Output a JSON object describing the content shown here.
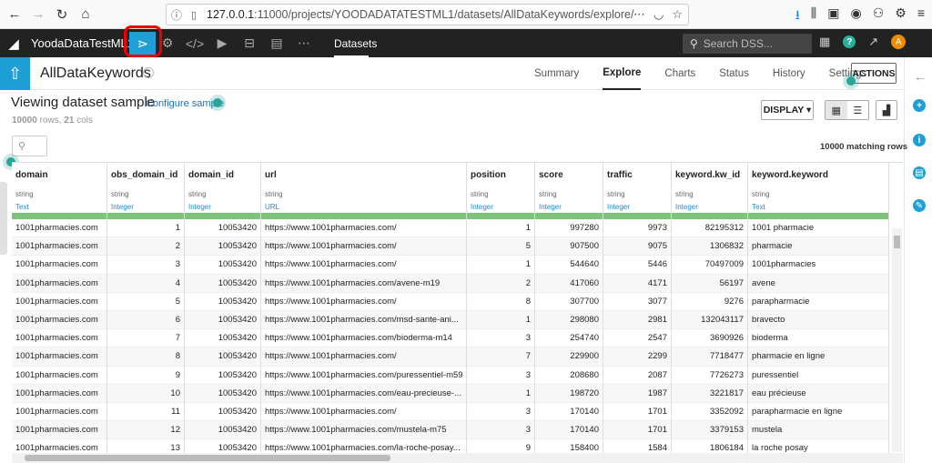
{
  "browser": {
    "url_host": "127.0.0.1",
    "url_rest": ":11000/projects/YOODADATATESTML1/datasets/AllDataKeywords/explore/",
    "more_icon": "⋯"
  },
  "dss": {
    "project_name": "YoodaDataTestML1",
    "nav_datasets": "Datasets",
    "search_placeholder": "Search DSS...",
    "avatar_letter": "A",
    "help_label": "?"
  },
  "dataset": {
    "name": "AllDataKeywords",
    "tabs": [
      "Summary",
      "Explore",
      "Charts",
      "Status",
      "History",
      "Settings"
    ],
    "actions_label": "ACTIONS"
  },
  "sample": {
    "title": "Viewing dataset sample",
    "configure_label": "Configure sample",
    "rows_label": "10000",
    "rows_suffix": "rows,",
    "cols_label": "21",
    "cols_suffix": "cols",
    "display_label": "DISPLAY ▾",
    "matching": "10000 matching rows"
  },
  "table": {
    "columns": [
      {
        "name": "domain",
        "storage": "string",
        "meaning": "Text"
      },
      {
        "name": "obs_domain_id",
        "storage": "string",
        "meaning": "Integer"
      },
      {
        "name": "domain_id",
        "storage": "string",
        "meaning": "Integer"
      },
      {
        "name": "url",
        "storage": "string",
        "meaning": "URL"
      },
      {
        "name": "position",
        "storage": "string",
        "meaning": "Integer"
      },
      {
        "name": "score",
        "storage": "string",
        "meaning": "Integer"
      },
      {
        "name": "traffic",
        "storage": "string",
        "meaning": "Integer"
      },
      {
        "name": "keyword.kw_id",
        "storage": "string",
        "meaning": "Integer"
      },
      {
        "name": "keyword.keyword",
        "storage": "string",
        "meaning": "Text"
      }
    ],
    "rows": [
      [
        "1001pharmacies.com",
        "1",
        "10053420",
        "https://www.1001pharmacies.com/",
        "1",
        "997280",
        "9973",
        "82195312",
        "1001 pharmacie"
      ],
      [
        "1001pharmacies.com",
        "2",
        "10053420",
        "https://www.1001pharmacies.com/",
        "5",
        "907500",
        "9075",
        "1306832",
        "pharmacie"
      ],
      [
        "1001pharmacies.com",
        "3",
        "10053420",
        "https://www.1001pharmacies.com/",
        "1",
        "544640",
        "5446",
        "70497009",
        "1001pharmacies"
      ],
      [
        "1001pharmacies.com",
        "4",
        "10053420",
        "https://www.1001pharmacies.com/avene-m19",
        "2",
        "417060",
        "4171",
        "56197",
        "avene"
      ],
      [
        "1001pharmacies.com",
        "5",
        "10053420",
        "https://www.1001pharmacies.com/",
        "8",
        "307700",
        "3077",
        "9276",
        "parapharmacie"
      ],
      [
        "1001pharmacies.com",
        "6",
        "10053420",
        "https://www.1001pharmacies.com/msd-sante-ani...",
        "1",
        "298080",
        "2981",
        "132043117",
        "bravecto"
      ],
      [
        "1001pharmacies.com",
        "7",
        "10053420",
        "https://www.1001pharmacies.com/bioderma-m14",
        "3",
        "254740",
        "2547",
        "3690926",
        "bioderma"
      ],
      [
        "1001pharmacies.com",
        "8",
        "10053420",
        "https://www.1001pharmacies.com/",
        "7",
        "229900",
        "2299",
        "7718477",
        "pharmacie en ligne"
      ],
      [
        "1001pharmacies.com",
        "9",
        "10053420",
        "https://www.1001pharmacies.com/puressentiel-m59",
        "3",
        "208680",
        "2087",
        "7726273",
        "puressentiel"
      ],
      [
        "1001pharmacies.com",
        "10",
        "10053420",
        "https://www.1001pharmacies.com/eau-precieuse-...",
        "1",
        "198720",
        "1987",
        "3221817",
        "eau précieuse"
      ],
      [
        "1001pharmacies.com",
        "11",
        "10053420",
        "https://www.1001pharmacies.com/",
        "3",
        "170140",
        "1701",
        "3352092",
        "parapharmacie en ligne"
      ],
      [
        "1001pharmacies.com",
        "12",
        "10053420",
        "https://www.1001pharmacies.com/mustela-m75",
        "3",
        "170140",
        "1701",
        "3379153",
        "mustela"
      ],
      [
        "1001pharmacies.com",
        "13",
        "10053420",
        "https://www.1001pharmacies.com/la-roche-posay...",
        "9",
        "158400",
        "1584",
        "1806184",
        "la roche posay"
      ]
    ]
  }
}
